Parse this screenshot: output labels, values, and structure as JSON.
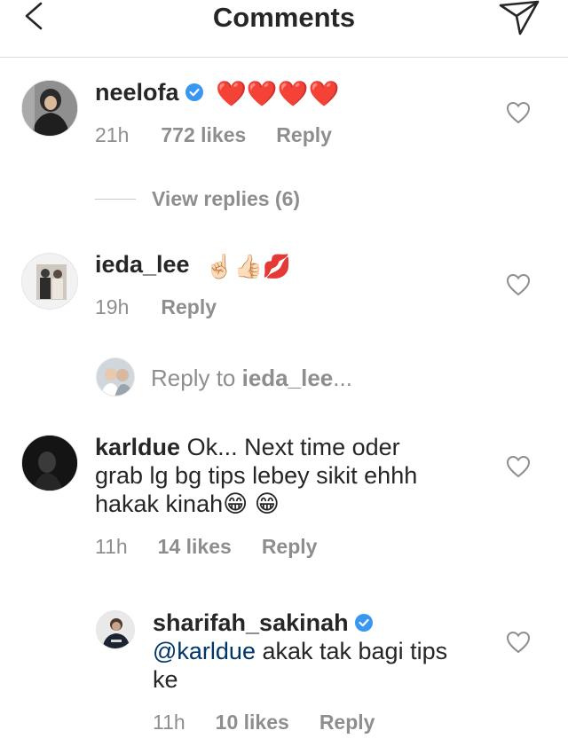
{
  "header": {
    "title": "Comments",
    "back_icon": "chevron-left-icon",
    "send_icon": "paper-plane-icon"
  },
  "comments": [
    {
      "username": "neelofa",
      "verified": true,
      "text": "❤️❤️❤️❤️",
      "time": "21h",
      "likes": "772 likes",
      "reply": "Reply"
    },
    {
      "username": "ieda_lee",
      "verified": false,
      "text": "☝🏻👍🏻💋",
      "time": "19h",
      "reply": "Reply"
    },
    {
      "username": "karldue",
      "verified": false,
      "text_line1": "Ok... Next time oder",
      "text_line2": "grab lg bg tips lebey sikit ehhh",
      "text_line3": "hakak kinah😁 😁",
      "time": "11h",
      "likes": "14 likes",
      "reply": "Reply"
    },
    {
      "username": "sharifah_sakinah",
      "verified": true,
      "mention": "@karldue",
      "text_line1": " akak tak bagi tips",
      "text_line2": "ke",
      "time": "11h",
      "likes": "10 likes",
      "reply": "Reply"
    }
  ],
  "view_replies": "View replies (6)",
  "reply_to": {
    "prefix": "Reply to ",
    "username": "ieda_lee",
    "suffix": "..."
  },
  "colors": {
    "text": "#262626",
    "meta": "#8e8e8e",
    "verified": "#3897f0",
    "mention": "#003569"
  }
}
